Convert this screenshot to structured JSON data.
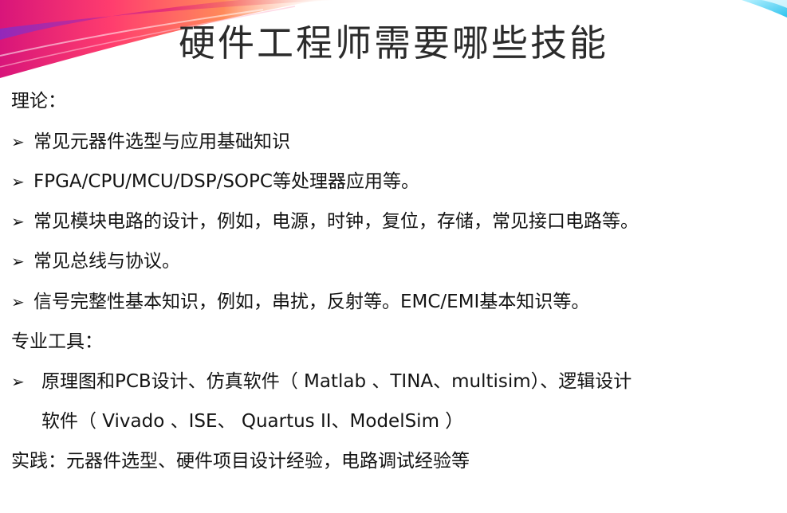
{
  "slide": {
    "title": "硬件工程师需要哪些技能",
    "sections": [
      {
        "heading": "理论：",
        "bullets": [
          "常见元器件选型与应用基础知识",
          "FPGA/CPU/MCU/DSP/SOPC等处理器应用等。",
          "常见模块电路的设计，例如，电源，时钟，复位，存储，常见接口电路等。",
          "常见总线与协议。",
          "信号完整性基本知识，例如，串扰，反射等。EMC/EMI基本知识等。"
        ]
      },
      {
        "heading": "专业工具：",
        "bullets": [
          "原理图和PCB设计、仿真软件（ Matlab 、TINA、multisim）、逻辑设计"
        ],
        "continuation": "软件（ Vivado 、ISE、 Quartus II、ModelSim ）"
      },
      {
        "heading": "实践：元器件选型、硬件项目设计经验，电路调试经验等"
      }
    ],
    "bullet_glyph": "➢",
    "colors": {
      "title_text": "#2b2b2b",
      "body_text": "#141414",
      "swoosh_magenta": "#e0207a",
      "swoosh_orange": "#ff6a3d",
      "swoosh_purple": "#a23ad6",
      "corner_cyan": "#3fd0f0"
    }
  }
}
